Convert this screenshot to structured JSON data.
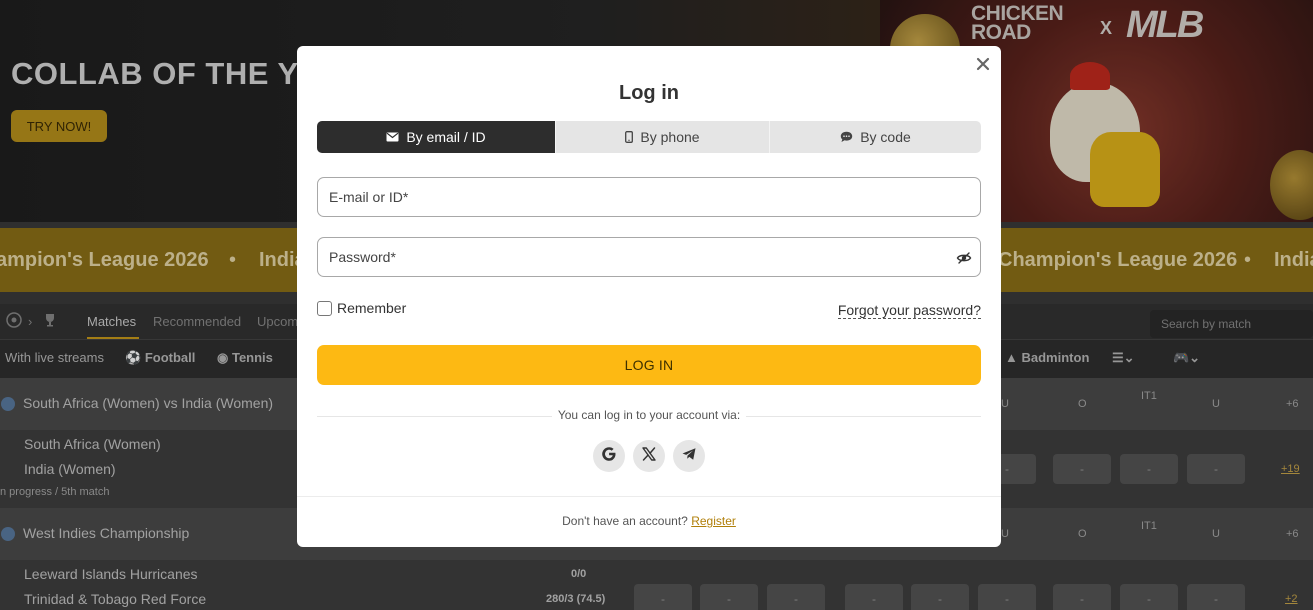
{
  "hero": {
    "title": "COLLAB OF THE Y",
    "cta_label": "TRY NOW!",
    "logo_left": "CHICKEN ROAD",
    "logo_x": "X",
    "logo_right": "MLB"
  },
  "ticker": {
    "items": [
      "ampion's League 2026",
      "India",
      "Champion's League 2026",
      "India"
    ]
  },
  "filters": {
    "tabs": [
      "Matches",
      "Recommended",
      "Upcom"
    ],
    "active_tab": "Matches",
    "search_placeholder": "Search by match"
  },
  "sports": {
    "items": [
      "With live streams",
      "Football",
      "Tennis",
      "Badminton"
    ]
  },
  "events": [
    {
      "league": "South Africa (Women) vs India (Women)",
      "col_labels": [
        "U",
        "O",
        "IT1",
        "U",
        "+6"
      ],
      "team1": "South Africa (Women)",
      "team2": "India (Women)",
      "status": "n progress / 5th match",
      "odds": [
        "-",
        "-",
        "-",
        "-"
      ],
      "more": "+19"
    },
    {
      "league": "West Indies Championship",
      "col_labels": [
        "U",
        "O",
        "IT1",
        "U",
        "+6"
      ],
      "team1": "Leeward Islands Hurricanes",
      "team2": "Trinidad & Tobago Red Force",
      "score1": "0/0",
      "score2": "280/3 (74.5)",
      "odds": [
        "-",
        "-",
        "-",
        "-",
        "-",
        "-",
        "-",
        "-",
        "-"
      ],
      "more": "+2"
    }
  ],
  "modal": {
    "title": "Log in",
    "tabs": [
      {
        "label": "By email / ID",
        "icon": "envelope-icon",
        "active": true
      },
      {
        "label": "By phone",
        "icon": "phone-icon",
        "active": false
      },
      {
        "label": "By code",
        "icon": "chat-icon",
        "active": false
      }
    ],
    "email_placeholder": "E-mail or ID*",
    "password_placeholder": "Password*",
    "remember_label": "Remember",
    "forgot_label": "Forgot your password?",
    "login_label": "LOG IN",
    "via_text": "You can log in to your account via:",
    "social": [
      "google-icon",
      "x-icon",
      "telegram-icon"
    ],
    "footer_text": "Don't have an account?",
    "register_label": "Register"
  },
  "colors": {
    "accent": "#fdb913",
    "tab_active": "#2d2d2d",
    "link": "#b07f0a"
  }
}
